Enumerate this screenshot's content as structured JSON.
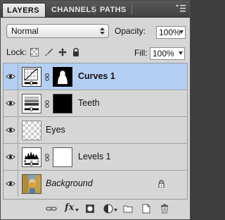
{
  "tabs": [
    {
      "label": "LAYERS",
      "active": true
    },
    {
      "label": "CHANNELS",
      "active": false
    },
    {
      "label": "PATHS",
      "active": false
    }
  ],
  "panel_menu_icon": "panel-menu-icon",
  "blend_mode": "Normal",
  "opacity": {
    "label": "Opacity:",
    "value": "100%"
  },
  "lock": {
    "label": "Lock:",
    "icons": [
      "lock-transparent-pixels-icon",
      "lock-image-pixels-icon",
      "lock-position-icon",
      "lock-all-icon"
    ]
  },
  "fill": {
    "label": "Fill:",
    "value": "100%"
  },
  "layers": [
    {
      "name": "Curves 1",
      "type": "curves-adjustment",
      "has_mask": true,
      "selected": true,
      "visible": true
    },
    {
      "name": "Teeth",
      "type": "brightness-adjustment",
      "has_mask": true,
      "selected": false,
      "visible": true
    },
    {
      "name": "Eyes",
      "type": "pixel-transparent",
      "has_mask": false,
      "selected": false,
      "visible": true
    },
    {
      "name": "Levels 1",
      "type": "levels-adjustment",
      "has_mask": true,
      "selected": false,
      "visible": true
    },
    {
      "name": "Background",
      "type": "background",
      "has_mask": false,
      "selected": false,
      "visible": true,
      "locked": true
    }
  ],
  "bottom_icons": [
    "link-layers-icon",
    "fx-icon",
    "add-mask-icon",
    "new-adjustment-icon",
    "new-group-icon",
    "new-layer-icon",
    "delete-layer-icon"
  ],
  "fx_label": "fx",
  "colors": {
    "panel_bg": "#d6d6d6",
    "selected_row": "#b3cff3",
    "tab_bar": "#474747"
  }
}
